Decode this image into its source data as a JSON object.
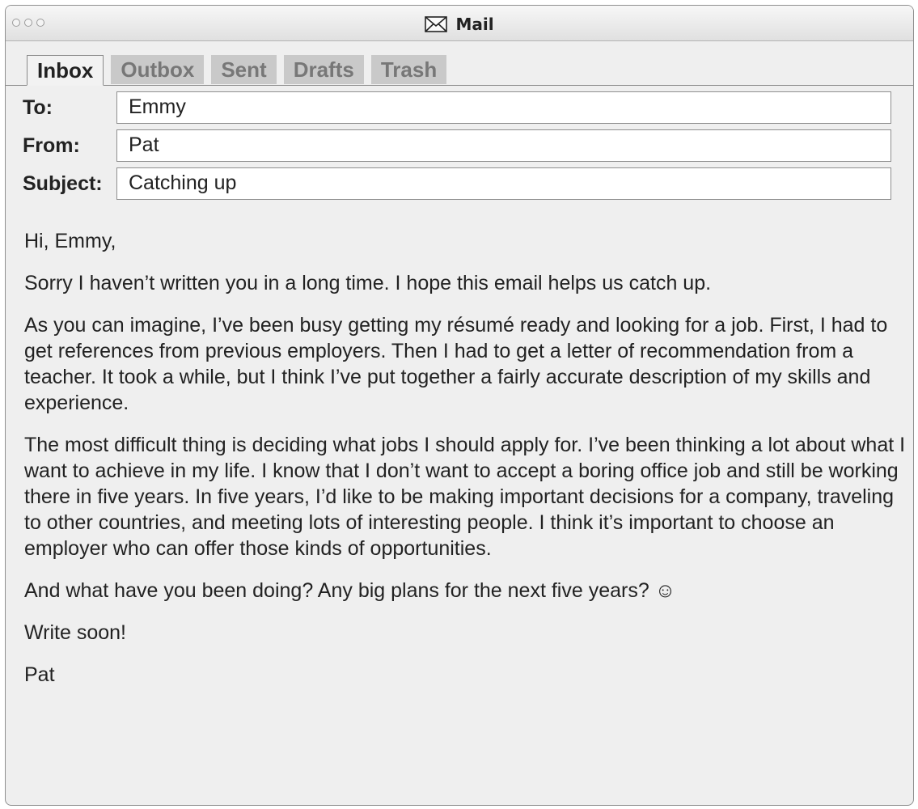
{
  "window": {
    "title": "Mail",
    "title_icon": "envelope-icon"
  },
  "tabs": [
    {
      "label": "Inbox",
      "active": true
    },
    {
      "label": "Outbox",
      "active": false
    },
    {
      "label": "Sent",
      "active": false
    },
    {
      "label": "Drafts",
      "active": false
    },
    {
      "label": "Trash",
      "active": false
    }
  ],
  "header": {
    "to_label": "To:",
    "to_value": "Emmy",
    "from_label": "From:",
    "from_value": "Pat",
    "subject_label": "Subject:",
    "subject_value": "Catching up"
  },
  "message": {
    "greeting": "Hi, Emmy,",
    "paragraphs": [
      "Sorry I haven’t written you in a long time. I hope this email helps us catch up.",
      "As you can imagine, I’ve been busy getting my résumé ready and looking for a job. First, I had to get references from previous employers. Then I had to get a letter of recommendation from a teacher. It took a while, but I think I’ve put together a fairly accurate description of my skills and experience.",
      "The most difficult thing is deciding what jobs I should apply for. I’ve been thinking a lot about what I want to achieve in my life. I know that I don’t want to accept a boring office job and still be working there in five years. In five years, I’d like to be making important decisions for a company, traveling to other countries, and meeting lots of interesting people. I think it’s important to choose an employer who can offer those kinds of opportunities.",
      "And what have you been doing? Any big plans for the next five years? ☺"
    ],
    "closing": "Write soon!",
    "signature": "Pat"
  }
}
